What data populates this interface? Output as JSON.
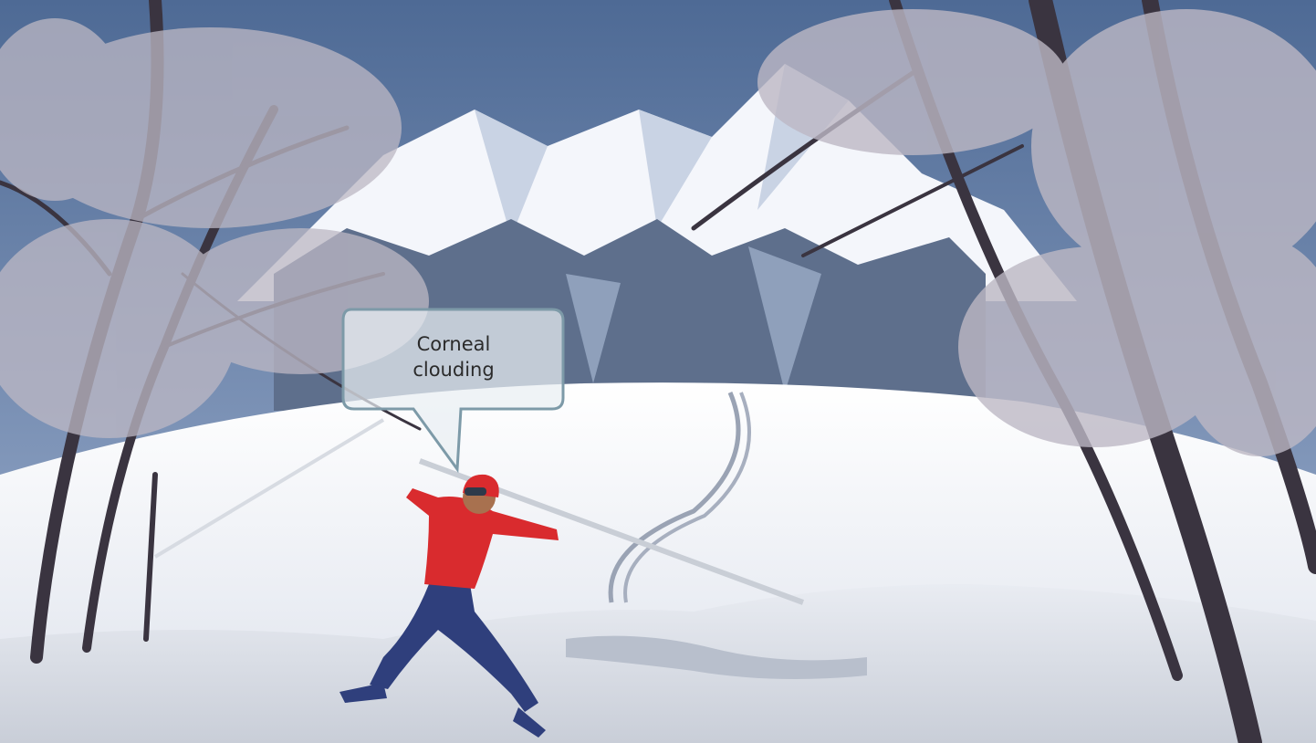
{
  "callout": {
    "text": "Corneal clouding"
  },
  "colors": {
    "sky": "#5f7aa3",
    "snow": "#eef1f7",
    "trunk": "#3a3440",
    "foliage_frost": "#bdb8c4",
    "shirt": "#d92b2e",
    "pants": "#2f3f7c",
    "callout_border": "#7d9aa8"
  },
  "icons": [
    "speech-bubble-icon"
  ]
}
